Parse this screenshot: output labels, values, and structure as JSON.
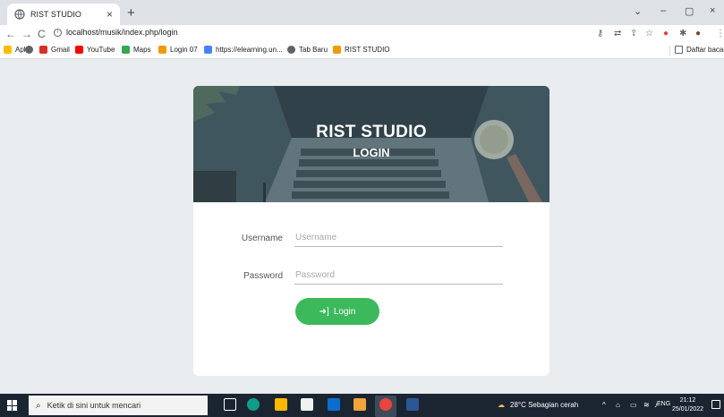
{
  "browser": {
    "tab": {
      "title": "RIST STUDIO",
      "close": "×",
      "favicon": "globe-icon"
    },
    "new_tab": "+",
    "window_controls": {
      "list": "⌄",
      "minimize": "–",
      "maximize": "▢",
      "close": "×"
    },
    "nav": {
      "back": "←",
      "forward": "→",
      "reload": "C"
    },
    "url": "localhost/musik/index.php/login",
    "bookmarks": [
      {
        "label": "Apl",
        "icon": "apps-icon",
        "color": "#fbbc04"
      },
      {
        "label": "",
        "icon": "globe-icon",
        "color": "#5f6368"
      },
      {
        "label": "Gmail",
        "icon": "gmail-icon",
        "color": "#d93025"
      },
      {
        "label": "YouTube",
        "icon": "youtube-icon",
        "color": "#ff0000"
      },
      {
        "label": "Maps",
        "icon": "maps-icon",
        "color": "#34a853"
      },
      {
        "label": "Login 07",
        "icon": "bookmark-icon",
        "color": "#f29900"
      },
      {
        "label": "https://elearning.un...",
        "icon": "google-icon",
        "color": "#4285f4"
      },
      {
        "label": "Tab Baru",
        "icon": "globe-icon",
        "color": "#5f6368"
      },
      {
        "label": "RIST STUDIO",
        "icon": "bookmark-icon",
        "color": "#f29900"
      }
    ],
    "reading_list": "Daftar bacaa"
  },
  "login": {
    "title": "RIST STUDIO",
    "subtitle": "LOGIN",
    "username_label": "Username",
    "username_placeholder": "Username",
    "username_value": "",
    "password_label": "Password",
    "password_placeholder": "Password",
    "password_value": "",
    "button_label": "Login",
    "button_color": "#3cb95b"
  },
  "taskbar": {
    "search_placeholder": "Ketik di sini untuk mencari",
    "weather": "28°C  Sebagian cerah",
    "language": "ENG",
    "time": "21:12",
    "date": "25/01/2022"
  }
}
